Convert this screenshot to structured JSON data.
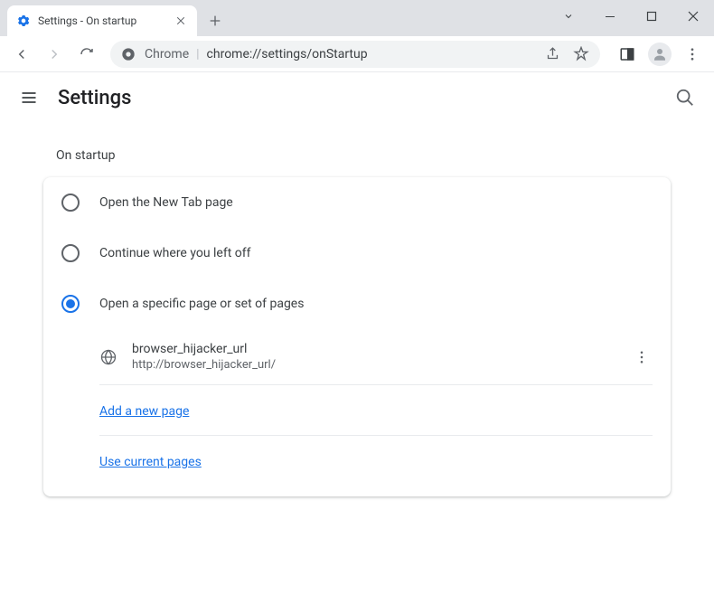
{
  "window": {
    "tab_title": "Settings - On startup"
  },
  "omnibox": {
    "origin": "Chrome",
    "path": "chrome://settings/onStartup"
  },
  "header": {
    "title": "Settings"
  },
  "section": {
    "label": "On startup",
    "options": {
      "new_tab": "Open the New Tab page",
      "continue": "Continue where you left off",
      "specific": "Open a specific page or set of pages"
    },
    "pages": [
      {
        "name": "browser_hijacker_url",
        "url": "http://browser_hijacker_url/"
      }
    ],
    "add_page": "Add a new page",
    "use_current": "Use current pages"
  }
}
